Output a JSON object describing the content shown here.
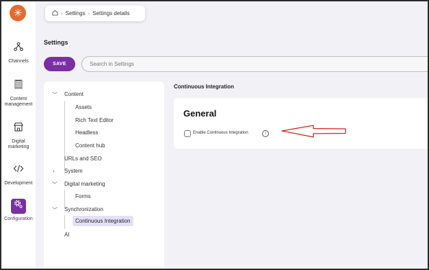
{
  "rail": {
    "logo_icon": "asterisk-logo-icon",
    "items": [
      {
        "label": "Channels",
        "icon": "channels-icon"
      },
      {
        "label": "Content management",
        "icon": "content-icon"
      },
      {
        "label": "Digital marketing",
        "icon": "store-icon"
      },
      {
        "label": "Development",
        "icon": "code-icon"
      },
      {
        "label": "Configuration",
        "icon": "gear-icon"
      }
    ]
  },
  "breadcrumb": {
    "home_icon": "home-icon",
    "items": [
      "Settings",
      "Settings details"
    ]
  },
  "page": {
    "title": "Settings",
    "save_label": "SAVE",
    "search_placeholder": "Search in Settings"
  },
  "tree": {
    "items": {
      "content": "Content",
      "assets": "Assets",
      "rich_text_editor": "Rich Text Editor",
      "headless": "Headless",
      "content_hub": "Content hub",
      "urls_seo": "URLs and SEO",
      "system": "System",
      "digital_marketing": "Digital marketing",
      "forms": "Forms",
      "synchronization": "Synchronization",
      "continuous_integration": "Continuous Integration",
      "ai": "AI"
    }
  },
  "main": {
    "section_title": "Continuous Integration",
    "card_title": "General",
    "checkbox_label": "Enable Continuous Integration",
    "checkbox_checked": false,
    "annotation_color": "#d42020",
    "accent_color": "#7a2fa4"
  }
}
